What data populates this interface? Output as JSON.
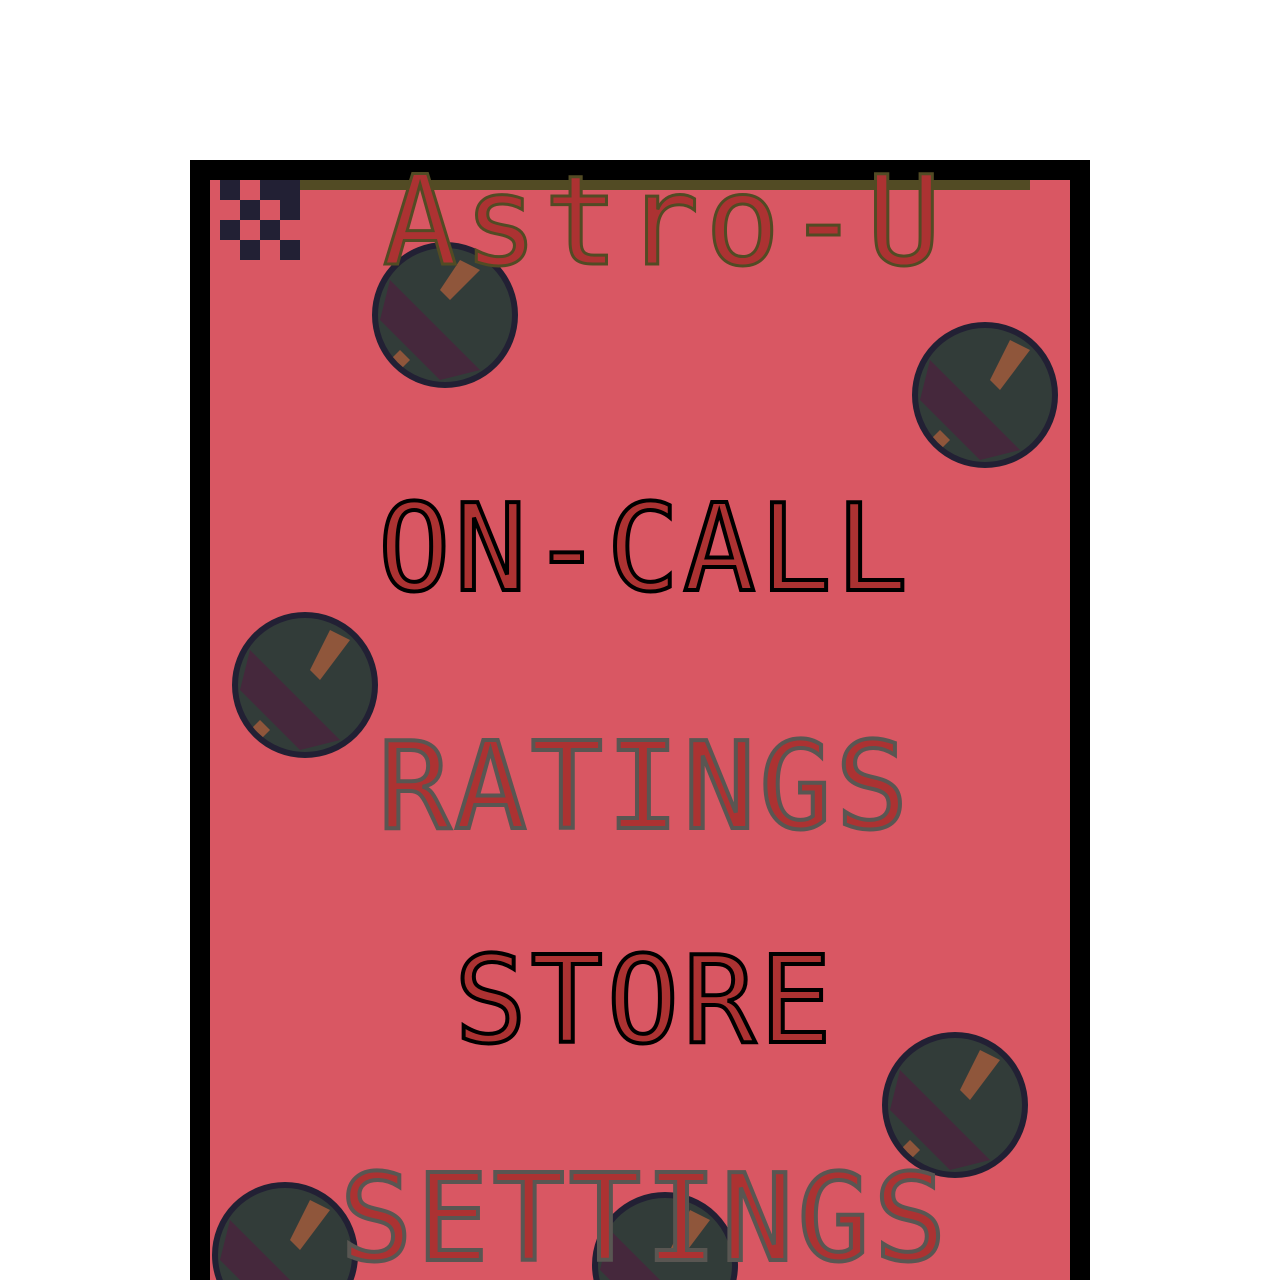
{
  "title": {
    "text": "Astro-U"
  },
  "menu": {
    "items": [
      {
        "label": "ON-CALL"
      },
      {
        "label": "RATINGS"
      },
      {
        "label": "STORE"
      },
      {
        "label": "SETTINGS"
      }
    ]
  },
  "colors": {
    "background": "#ffffff",
    "frame": "#000000",
    "screen": "#d95763",
    "logo_fill": "#ac3232",
    "logo_outline": "#524b24",
    "menu_active": "#000000",
    "menu_inactive": "#595652",
    "menu_fill": "#ac3232",
    "ball_dark": "#323c39",
    "ball_band": "#45283c",
    "ball_stripe": "#8f563b",
    "ball_outline": "#222034",
    "badge": "#222034"
  },
  "icons": {
    "badge": "checker-emblem-icon",
    "balls": "planet-ball-icon"
  }
}
